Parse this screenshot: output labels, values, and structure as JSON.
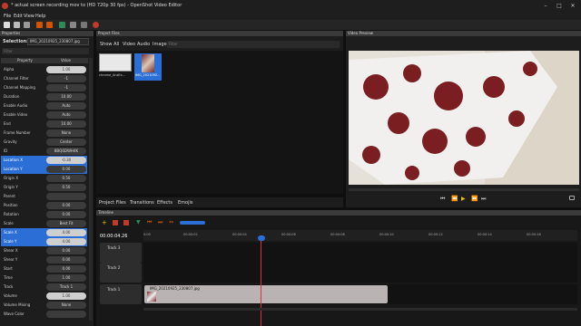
{
  "window": {
    "title": "* actual screen recording mov to (HD 720p 30 fps) - OpenShot Video Editor",
    "minimize": "–",
    "maximize": "□",
    "close": "✕"
  },
  "menu": [
    "File",
    "Edit",
    "View",
    "Help"
  ],
  "toolbar_icons": [
    "new-project-icon",
    "open-project-icon",
    "save-project-icon",
    "undo-icon",
    "redo-icon",
    "import-files-icon",
    "profile-icon",
    "fullscreen-icon",
    "export-video-icon"
  ],
  "properties": {
    "header": "Properties",
    "selection_label": "Selection:",
    "selection_value": "IMG_20210925_230807.jpg",
    "filter_placeholder": "Filter",
    "col_property": "Property",
    "col_value": "Value",
    "rows": [
      {
        "k": "Alpha",
        "v": "1.00"
      },
      {
        "k": "Channel Filter",
        "v": "-1"
      },
      {
        "k": "Channel Mapping",
        "v": "-1"
      },
      {
        "k": "Duration",
        "v": "10.00"
      },
      {
        "k": "Enable Audio",
        "v": "Auto"
      },
      {
        "k": "Enable Video",
        "v": "Auto"
      },
      {
        "k": "End",
        "v": "10.00"
      },
      {
        "k": "Frame Number",
        "v": "None"
      },
      {
        "k": "Gravity",
        "v": "Center"
      },
      {
        "k": "ID",
        "v": "8BQ6DWH4K"
      },
      {
        "k": "Location X",
        "v": "-0.30"
      },
      {
        "k": "Location Y",
        "v": "0.00"
      },
      {
        "k": "Origin X",
        "v": "0.50"
      },
      {
        "k": "Origin Y",
        "v": "0.50"
      },
      {
        "k": "Parent",
        "v": ""
      },
      {
        "k": "Position",
        "v": "0.00"
      },
      {
        "k": "Rotation",
        "v": "0.00"
      },
      {
        "k": "Scale",
        "v": "Best Fit"
      },
      {
        "k": "Scale X",
        "v": "4.00"
      },
      {
        "k": "Scale Y",
        "v": "4.00"
      },
      {
        "k": "Shear X",
        "v": "0.00"
      },
      {
        "k": "Shear Y",
        "v": "0.00"
      },
      {
        "k": "Start",
        "v": "0.00"
      },
      {
        "k": "Time",
        "v": "1.00"
      },
      {
        "k": "Track",
        "v": "Track 1"
      },
      {
        "k": "Volume",
        "v": "1.00"
      },
      {
        "k": "Volume Mixing",
        "v": "None"
      },
      {
        "k": "Wave Color",
        "v": ""
      }
    ]
  },
  "project_files": {
    "header": "Project Files",
    "filters": [
      "Show All",
      "Video",
      "Audio",
      "Image"
    ],
    "filter_placeholder": "Filter",
    "files": [
      "chrome_AnzEx...",
      "IMG_2021092..."
    ]
  },
  "bottom_tabs": [
    "Project Files",
    "Transitions",
    "Effects",
    "Emojis"
  ],
  "video_preview": {
    "header": "Video Preview"
  },
  "timeline": {
    "header": "Timeline",
    "timecode": "00:00:04.26",
    "ticks": [
      "0:00",
      "00:00:02",
      "00:00:04",
      "00:00:06",
      "00:00:08",
      "00:00:10",
      "00:00:12",
      "00:00:14",
      "00:00:16"
    ],
    "tracks": [
      "Track 3",
      "Track 2",
      "Track 1"
    ],
    "clip_name": "IMG_20210925_230807.jpg"
  }
}
